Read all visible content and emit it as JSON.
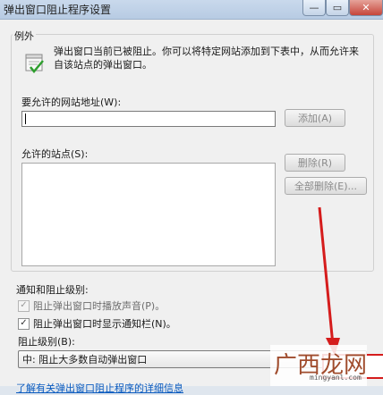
{
  "window": {
    "title": "弹出窗口阻止程序设置",
    "min_glyph": "—",
    "max_glyph": "▭",
    "close_glyph": "✕"
  },
  "exceptions": {
    "legend": "例外",
    "description": "弹出窗口当前已被阻止。你可以将特定网站添加到下表中，从而允许来自该站点的弹出窗口。",
    "address_label": "要允许的网站地址(W):",
    "address_value": "",
    "add_button": "添加(A)",
    "allowed_label": "允许的站点(S):",
    "remove_button": "删除(R)",
    "remove_all_button": "全部删除(E)..."
  },
  "notifications": {
    "section_label": "通知和阻止级别:",
    "play_sound": {
      "label": "阻止弹出窗口时播放声音(P)。",
      "checked": true,
      "disabled": true
    },
    "show_bar": {
      "label": "阻止弹出窗口时显示通知栏(N)。",
      "checked": true,
      "disabled": false
    },
    "level_label": "阻止级别(B):",
    "level_value": "中: 阻止大多数自动弹出窗口",
    "level_arrow": "▼"
  },
  "footer": {
    "learn_more_link": "了解有关弹出窗口阻止程序的详细信息"
  },
  "watermark": {
    "text": "广西龙网",
    "url": "mingyanl.com"
  },
  "colors": {
    "link": "#0b5bbf",
    "highlight_red": "#d51c1c"
  }
}
